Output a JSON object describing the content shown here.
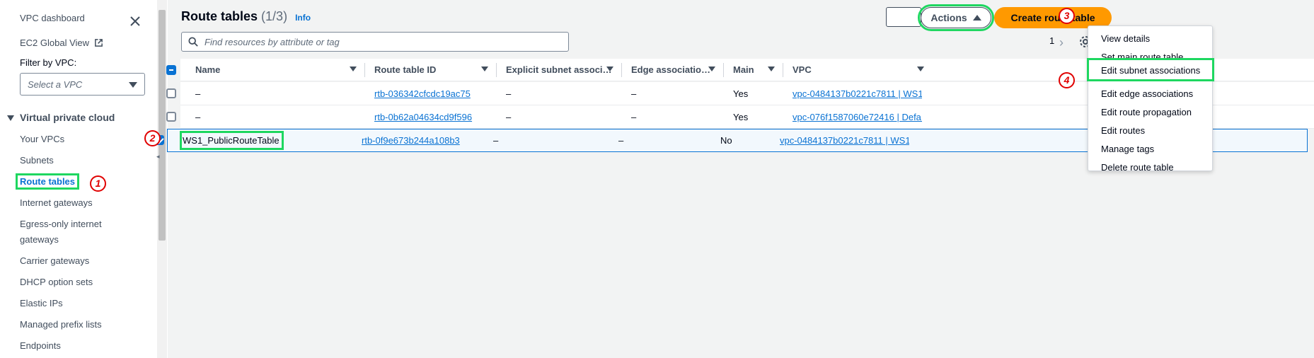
{
  "sidebar": {
    "dashboard": "VPC dashboard",
    "ec2_global_view": "EC2 Global View",
    "filter_label": "Filter by VPC:",
    "select_placeholder": "Select a VPC",
    "section": "Virtual private cloud",
    "items": [
      {
        "label": "Your VPCs"
      },
      {
        "label": "Subnets"
      },
      {
        "label": "Route tables"
      },
      {
        "label": "Internet gateways"
      },
      {
        "label": "Egress-only internet"
      },
      {
        "label": "gateways"
      },
      {
        "label": "Carrier gateways"
      },
      {
        "label": "DHCP option sets"
      },
      {
        "label": "Elastic IPs"
      },
      {
        "label": "Managed prefix lists"
      },
      {
        "label": "Endpoints"
      }
    ]
  },
  "header": {
    "title": "Route tables",
    "count": "(1/3)",
    "info": "Info",
    "search_placeholder": "Find resources by attribute or tag",
    "actions_label": "Actions",
    "create_label": "Create route table",
    "page_number": "1"
  },
  "table": {
    "columns": [
      "Name",
      "Route table ID",
      "Explicit subnet associ…",
      "Edge associatio…",
      "Main",
      "VPC"
    ],
    "rows": [
      {
        "name": "–",
        "id": "rtb-036342cfcdc19ac75",
        "explicit": "–",
        "edge": "–",
        "main": "Yes",
        "vpc": "vpc-0484137b0221c7811 | WS1…",
        "selected": false
      },
      {
        "name": "–",
        "id": "rtb-0b62a04634cd9f596",
        "explicit": "–",
        "edge": "–",
        "main": "Yes",
        "vpc": "vpc-076f1587060e72416 | Defa…",
        "selected": false
      },
      {
        "name": "WS1_PublicRouteTable",
        "id": "rtb-0f9e673b244a108b3",
        "explicit": "–",
        "edge": "–",
        "main": "No",
        "vpc": "vpc-0484137b0221c7811 | WS1…",
        "selected": true
      }
    ]
  },
  "actions_menu": {
    "items": [
      "View details",
      "Set main route table",
      "Edit subnet associations",
      "Edit edge associations",
      "Edit route propagation",
      "Edit routes",
      "Manage tags",
      "Delete route table"
    ]
  },
  "annotations": [
    "1",
    "2",
    "3",
    "4"
  ],
  "colors": {
    "accent": "#0972d3",
    "primary_button": "#ff9900",
    "highlight": "#1ed760",
    "annotation": "#e00000"
  }
}
